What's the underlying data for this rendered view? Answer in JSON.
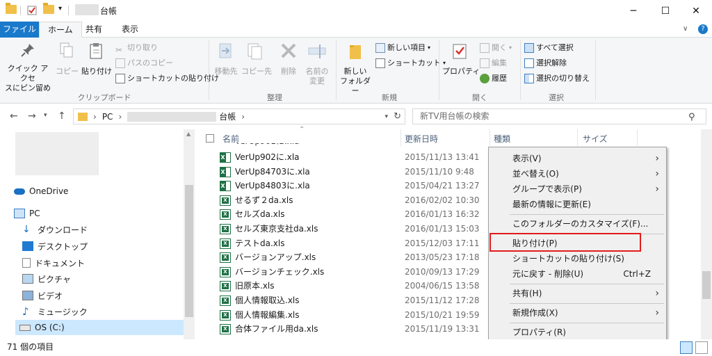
{
  "titlebar": {
    "title": "台帳",
    "minimize": "─",
    "maximize": "☐",
    "close": "✕"
  },
  "ribbon_tabs": [
    "ファイル",
    "ホーム",
    "共有",
    "表示"
  ],
  "ribbon": {
    "clipboard": {
      "pin": "クイック アクセ\nスにピン留め",
      "copy": "コピー",
      "paste": "貼り付け",
      "cut": "切り取り",
      "copy_path": "パスのコピー",
      "paste_shortcut": "ショートカットの貼り付け",
      "group": "クリップボード"
    },
    "organize": {
      "move_to": "移動先",
      "copy_to": "コピー先",
      "delete": "削除",
      "rename": "名前の\n変更",
      "group": "整理"
    },
    "new": {
      "new_folder": "新しい\nフォルダー",
      "new_item": "新しい項目",
      "easy_access": "ショートカット",
      "group": "新規"
    },
    "open": {
      "properties": "プロパティ",
      "open": "開く",
      "edit": "編集",
      "history": "履歴",
      "group": "開く"
    },
    "select": {
      "select_all": "すべて選択",
      "select_none": "選択解除",
      "invert": "選択の切り替え",
      "group": "選択"
    }
  },
  "address": {
    "crumb_pc": "PC",
    "crumb_folder": "台帳",
    "sep": "›",
    "search_placeholder": "新TV用台帳の検索"
  },
  "navpane": {
    "onedrive": "OneDrive",
    "pc": "PC",
    "downloads": "ダウンロード",
    "desktop": "デスクトップ",
    "documents": "ドキュメント",
    "pictures": "ピクチャ",
    "videos": "ビデオ",
    "music": "ミュージック",
    "osdrive": "OS (C:)"
  },
  "columns": {
    "name": "名前",
    "date": "更新日時",
    "type": "種類",
    "size": "サイズ"
  },
  "files": [
    {
      "name": "VerUp902に.xla",
      "date": "2015/11/13 13:41",
      "kind": "xla"
    },
    {
      "name": "VerUp84703に.xla",
      "date": "2015/11/10 9:48",
      "kind": "xla"
    },
    {
      "name": "VerUp84803に.xla",
      "date": "2015/04/21 13:27",
      "kind": "xla"
    },
    {
      "name": "せるず２da.xls",
      "date": "2016/02/02 10:30",
      "kind": "xls"
    },
    {
      "name": "セルズda.xls",
      "date": "2016/01/13 16:32",
      "kind": "xls"
    },
    {
      "name": "セルズ東京支社da.xls",
      "date": "2016/01/13 15:03",
      "kind": "xls"
    },
    {
      "name": "テストda.xls",
      "date": "2015/12/03 17:11",
      "kind": "xls"
    },
    {
      "name": "バージョンアップ.xls",
      "date": "2013/05/23 17:18",
      "kind": "xls"
    },
    {
      "name": "バージョンチェック.xls",
      "date": "2010/09/13 17:29",
      "kind": "xls"
    },
    {
      "name": "旧原本.xls",
      "date": "2004/06/15 13:58",
      "kind": "xls"
    },
    {
      "name": "個人情報取込.xls",
      "date": "2015/11/12 17:28",
      "kind": "xls"
    },
    {
      "name": "個人情報編集.xls",
      "date": "2015/10/21 19:59",
      "kind": "xls"
    },
    {
      "name": "合体ファイル用da.xls",
      "date": "2015/11/19 13:31",
      "kind": "xls"
    }
  ],
  "context_menu": {
    "view": "表示(V)",
    "sort": "並べ替え(O)",
    "group": "グループで表示(P)",
    "refresh": "最新の情報に更新(E)",
    "customize": "このフォルダーのカスタマイズ(F)...",
    "paste": "貼り付け(P)",
    "paste_shortcut": "ショートカットの貼り付け(S)",
    "undo": "元に戻す - 削除(U)",
    "undo_shortcut": "Ctrl+Z",
    "share": "共有(H)",
    "new": "新規作成(X)",
    "properties": "プロパティ(R)"
  },
  "statusbar": {
    "count": "71 個の項目"
  },
  "colors": {
    "accent": "#1979ca",
    "highlight_box": "#e21b1b",
    "selection": "#cce8ff"
  }
}
